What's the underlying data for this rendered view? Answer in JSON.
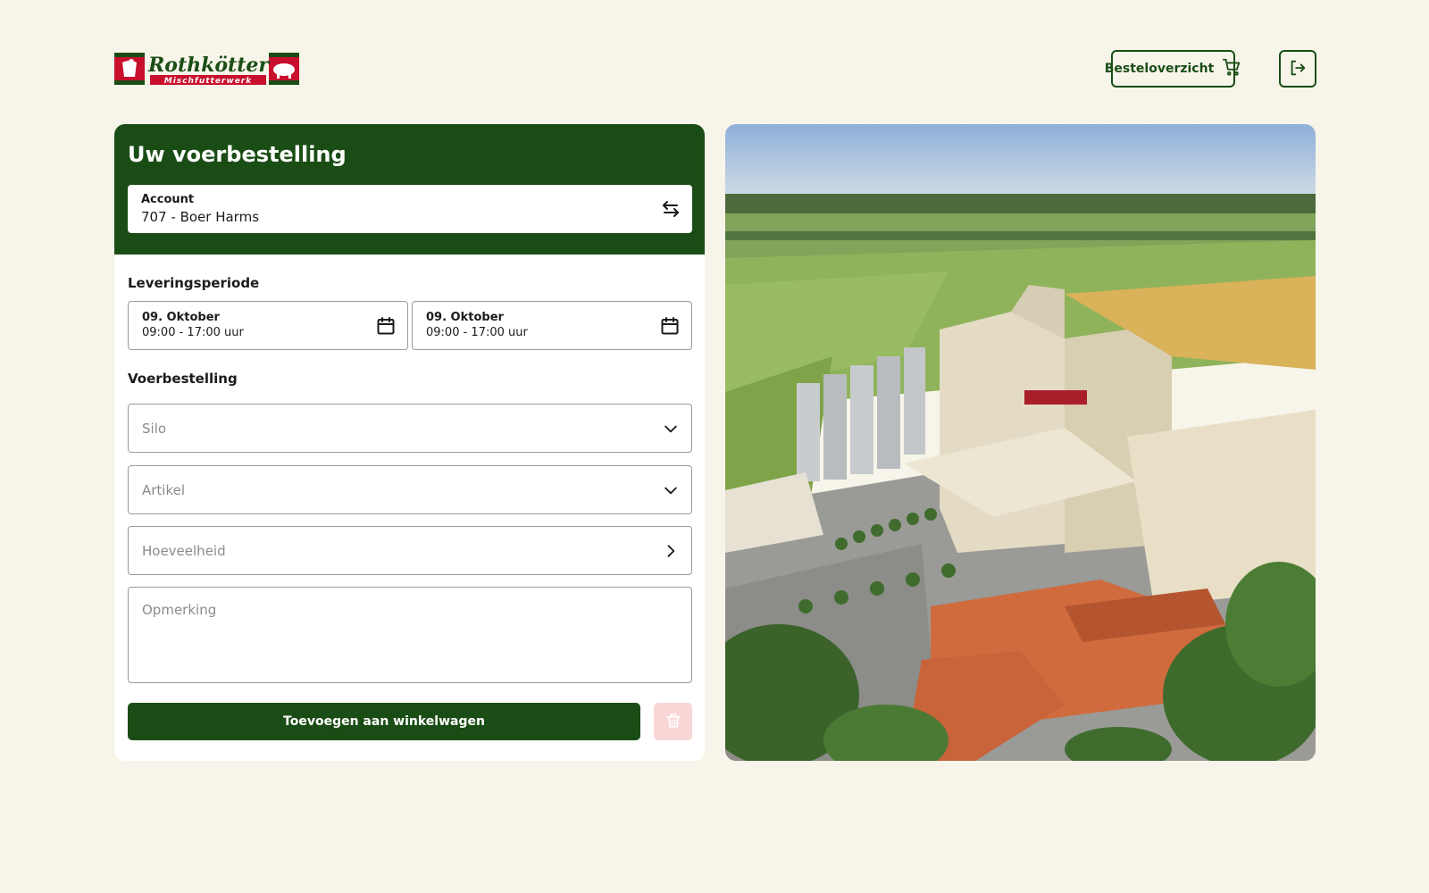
{
  "header": {
    "logo": {
      "brand": "Rothkötter",
      "sub": "Mischfutterwerk"
    },
    "overview_label": "Besteloverzicht"
  },
  "order": {
    "title": "Uw voerbestelling",
    "account": {
      "label": "Account",
      "value": "707 - Boer Harms"
    },
    "delivery": {
      "label": "Leveringsperiode",
      "from": {
        "day": "09. Oktober",
        "time": "09:00 - 17:00 uur"
      },
      "to": {
        "day": "09. Oktober",
        "time": "09:00 - 17:00 uur"
      }
    },
    "section_label": "Voerbestelling",
    "silo_placeholder": "Silo",
    "article_placeholder": "Artikel",
    "quantity_placeholder": "Hoeveelheid",
    "remark_placeholder": "Opmerking",
    "add_button": "Toevoegen aan winkelwagen"
  },
  "colors": {
    "primary": "#1a4d15",
    "background": "#f7f5ea",
    "delete_bg": "#f9d6d6"
  },
  "icons": [
    "cart-icon",
    "logout-icon",
    "swap-icon",
    "calendar-icon",
    "chevron-down-icon",
    "chevron-right-icon",
    "trash-icon"
  ]
}
